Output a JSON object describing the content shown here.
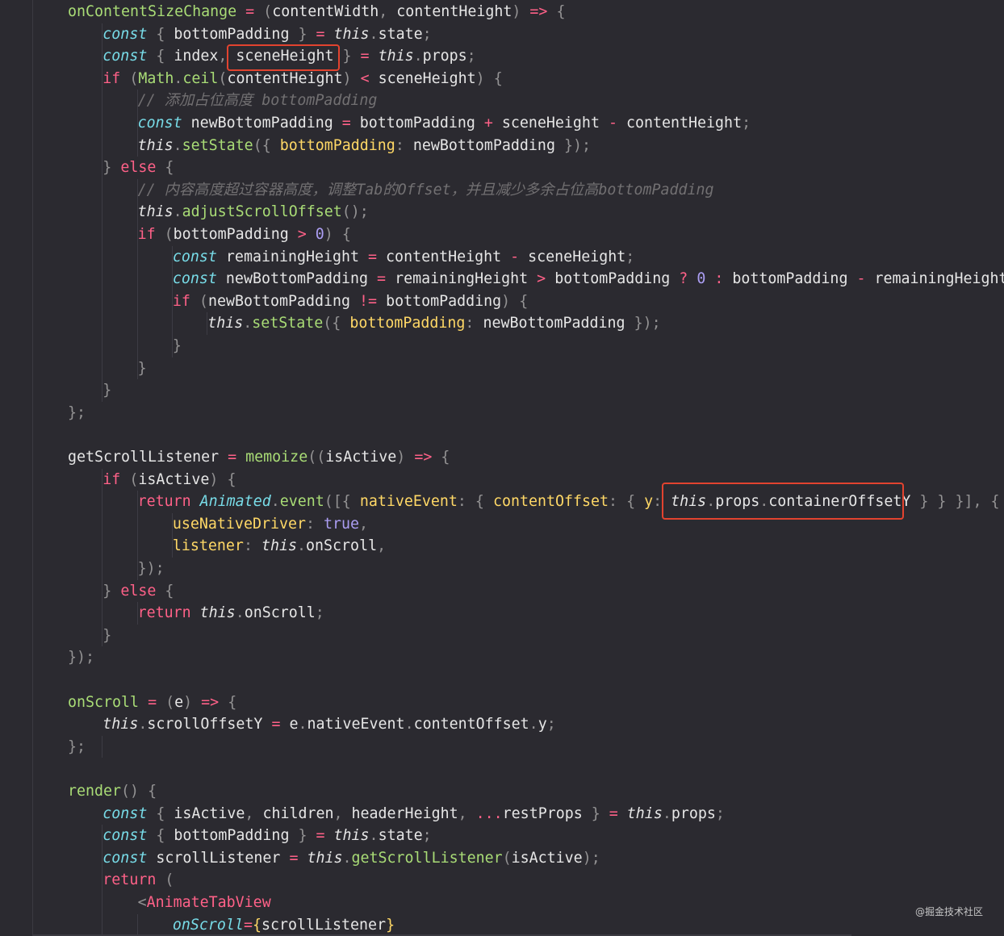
{
  "colors": {
    "background": "#2b2a30",
    "plain": "#e6e6e6",
    "function": "#a9dc76",
    "keyword": "#ff6188",
    "storage": "#78dce8",
    "this": "#e6e6e6",
    "punct": "#939293",
    "prop": "#ffd866",
    "number": "#ab9df2",
    "comment": "#727072",
    "highlight_border": "#e2432f"
  },
  "watermark": "@掘金技术社区",
  "lines": [
    {
      "indent": 2,
      "tokens": [
        [
          "onContentSizeChange",
          "fn"
        ],
        [
          " ",
          "pl"
        ],
        [
          "=",
          "kw"
        ],
        [
          " ",
          "pl"
        ],
        [
          "(",
          "pu"
        ],
        [
          "contentWidth",
          "pl"
        ],
        [
          ", ",
          "pu"
        ],
        [
          "contentHeight",
          "pl"
        ],
        [
          ")",
          "pu"
        ],
        [
          " ",
          "pl"
        ],
        [
          "=>",
          "kw"
        ],
        [
          " ",
          "pl"
        ],
        [
          "{",
          "pu"
        ]
      ]
    },
    {
      "indent": 3,
      "tokens": [
        [
          "const",
          "st"
        ],
        [
          " ",
          "pl"
        ],
        [
          "{",
          "pu"
        ],
        [
          " bottomPadding ",
          "pl"
        ],
        [
          "}",
          "pu"
        ],
        [
          " ",
          "pl"
        ],
        [
          "=",
          "kw"
        ],
        [
          " ",
          "pl"
        ],
        [
          "this",
          "th"
        ],
        [
          ".",
          "pu"
        ],
        [
          "state",
          "pl"
        ],
        [
          ";",
          "pu"
        ]
      ]
    },
    {
      "indent": 3,
      "tokens": [
        [
          "const",
          "st"
        ],
        [
          " ",
          "pl"
        ],
        [
          "{",
          "pu"
        ],
        [
          " index",
          "pl"
        ],
        [
          ",",
          "pu"
        ],
        [
          " sceneHeight ",
          "pl"
        ],
        [
          "}",
          "pu"
        ],
        [
          " ",
          "pl"
        ],
        [
          "=",
          "kw"
        ],
        [
          " ",
          "pl"
        ],
        [
          "this",
          "th"
        ],
        [
          ".",
          "pu"
        ],
        [
          "props",
          "pl"
        ],
        [
          ";",
          "pu"
        ]
      ]
    },
    {
      "indent": 3,
      "tokens": [
        [
          "if",
          "kw"
        ],
        [
          " ",
          "pl"
        ],
        [
          "(",
          "pu"
        ],
        [
          "Math",
          "fn"
        ],
        [
          ".",
          "pu"
        ],
        [
          "ceil",
          "fn"
        ],
        [
          "(",
          "pu"
        ],
        [
          "contentHeight",
          "pl"
        ],
        [
          ")",
          "pu"
        ],
        [
          " ",
          "pl"
        ],
        [
          "<",
          "kw"
        ],
        [
          " sceneHeight",
          "pl"
        ],
        [
          ")",
          "pu"
        ],
        [
          " ",
          "pl"
        ],
        [
          "{",
          "pu"
        ]
      ]
    },
    {
      "indent": 4,
      "tokens": [
        [
          "// 添加占位高度 bottomPadding",
          "cm"
        ]
      ]
    },
    {
      "indent": 4,
      "tokens": [
        [
          "const",
          "st"
        ],
        [
          " newBottomPadding ",
          "pl"
        ],
        [
          "=",
          "kw"
        ],
        [
          " bottomPadding ",
          "pl"
        ],
        [
          "+",
          "kw"
        ],
        [
          " sceneHeight ",
          "pl"
        ],
        [
          "-",
          "kw"
        ],
        [
          " contentHeight",
          "pl"
        ],
        [
          ";",
          "pu"
        ]
      ]
    },
    {
      "indent": 4,
      "tokens": [
        [
          "this",
          "th"
        ],
        [
          ".",
          "pu"
        ],
        [
          "setState",
          "fn"
        ],
        [
          "({",
          "pu"
        ],
        [
          " ",
          "pl"
        ],
        [
          "bottomPadding",
          "pr"
        ],
        [
          ":",
          "pu"
        ],
        [
          " newBottomPadding ",
          "pl"
        ],
        [
          "});",
          "pu"
        ]
      ]
    },
    {
      "indent": 3,
      "tokens": [
        [
          "}",
          "pu"
        ],
        [
          " ",
          "pl"
        ],
        [
          "else",
          "kw"
        ],
        [
          " ",
          "pl"
        ],
        [
          "{",
          "pu"
        ]
      ]
    },
    {
      "indent": 4,
      "tokens": [
        [
          "// 内容高度超过容器高度，调整Tab的Offset，并且减少多余占位高bottomPadding",
          "cm"
        ]
      ]
    },
    {
      "indent": 4,
      "tokens": [
        [
          "this",
          "th"
        ],
        [
          ".",
          "pu"
        ],
        [
          "adjustScrollOffset",
          "fn"
        ],
        [
          "();",
          "pu"
        ]
      ]
    },
    {
      "indent": 4,
      "tokens": [
        [
          "if",
          "kw"
        ],
        [
          " ",
          "pl"
        ],
        [
          "(",
          "pu"
        ],
        [
          "bottomPadding ",
          "pl"
        ],
        [
          ">",
          "kw"
        ],
        [
          " ",
          "pl"
        ],
        [
          "0",
          "nu"
        ],
        [
          ")",
          "pu"
        ],
        [
          " ",
          "pl"
        ],
        [
          "{",
          "pu"
        ]
      ]
    },
    {
      "indent": 5,
      "tokens": [
        [
          "const",
          "st"
        ],
        [
          " remainingHeight ",
          "pl"
        ],
        [
          "=",
          "kw"
        ],
        [
          " contentHeight ",
          "pl"
        ],
        [
          "-",
          "kw"
        ],
        [
          " sceneHeight",
          "pl"
        ],
        [
          ";",
          "pu"
        ]
      ]
    },
    {
      "indent": 5,
      "tokens": [
        [
          "const",
          "st"
        ],
        [
          " newBottomPadding ",
          "pl"
        ],
        [
          "=",
          "kw"
        ],
        [
          " remainingHeight ",
          "pl"
        ],
        [
          ">",
          "kw"
        ],
        [
          " bottomPadding ",
          "pl"
        ],
        [
          "?",
          "kw"
        ],
        [
          " ",
          "pl"
        ],
        [
          "0",
          "nu"
        ],
        [
          " ",
          "pl"
        ],
        [
          ":",
          "kw"
        ],
        [
          " bottomPadding ",
          "pl"
        ],
        [
          "-",
          "kw"
        ],
        [
          " remainingHeight",
          "pl"
        ],
        [
          ";",
          "pu"
        ]
      ]
    },
    {
      "indent": 5,
      "tokens": [
        [
          "if",
          "kw"
        ],
        [
          " ",
          "pl"
        ],
        [
          "(",
          "pu"
        ],
        [
          "newBottomPadding ",
          "pl"
        ],
        [
          "!=",
          "kw"
        ],
        [
          " bottomPadding",
          "pl"
        ],
        [
          ")",
          "pu"
        ],
        [
          " ",
          "pl"
        ],
        [
          "{",
          "pu"
        ]
      ]
    },
    {
      "indent": 6,
      "tokens": [
        [
          "this",
          "th"
        ],
        [
          ".",
          "pu"
        ],
        [
          "setState",
          "fn"
        ],
        [
          "({",
          "pu"
        ],
        [
          " ",
          "pl"
        ],
        [
          "bottomPadding",
          "pr"
        ],
        [
          ":",
          "pu"
        ],
        [
          " newBottomPadding ",
          "pl"
        ],
        [
          "});",
          "pu"
        ]
      ]
    },
    {
      "indent": 5,
      "tokens": [
        [
          "}",
          "pu"
        ]
      ]
    },
    {
      "indent": 4,
      "tokens": [
        [
          "}",
          "pu"
        ]
      ]
    },
    {
      "indent": 3,
      "tokens": [
        [
          "}",
          "pu"
        ]
      ]
    },
    {
      "indent": 2,
      "tokens": [
        [
          "};",
          "pu"
        ]
      ]
    },
    {
      "indent": 2,
      "tokens": []
    },
    {
      "indent": 2,
      "tokens": [
        [
          "getScrollListener ",
          "pl"
        ],
        [
          "=",
          "kw"
        ],
        [
          " ",
          "pl"
        ],
        [
          "memoize",
          "fn"
        ],
        [
          "((",
          "pu"
        ],
        [
          "isActive",
          "pl"
        ],
        [
          ")",
          "pu"
        ],
        [
          " ",
          "pl"
        ],
        [
          "=>",
          "kw"
        ],
        [
          " ",
          "pl"
        ],
        [
          "{",
          "pu"
        ]
      ]
    },
    {
      "indent": 3,
      "tokens": [
        [
          "if",
          "kw"
        ],
        [
          " ",
          "pl"
        ],
        [
          "(",
          "pu"
        ],
        [
          "isActive",
          "pl"
        ],
        [
          ")",
          "pu"
        ],
        [
          " ",
          "pl"
        ],
        [
          "{",
          "pu"
        ]
      ]
    },
    {
      "indent": 4,
      "tokens": [
        [
          "return",
          "kw"
        ],
        [
          " ",
          "pl"
        ],
        [
          "Animated",
          "st"
        ],
        [
          ".",
          "pu"
        ],
        [
          "event",
          "fn"
        ],
        [
          "([{",
          "pu"
        ],
        [
          " ",
          "pl"
        ],
        [
          "nativeEvent",
          "pr"
        ],
        [
          ":",
          "pu"
        ],
        [
          " ",
          "pl"
        ],
        [
          "{",
          "pu"
        ],
        [
          " ",
          "pl"
        ],
        [
          "contentOffset",
          "pr"
        ],
        [
          ":",
          "pu"
        ],
        [
          " ",
          "pl"
        ],
        [
          "{",
          "pu"
        ],
        [
          " ",
          "pl"
        ],
        [
          "y",
          "pr"
        ],
        [
          ":",
          "pu"
        ],
        [
          " ",
          "pl"
        ],
        [
          "this",
          "th"
        ],
        [
          ".",
          "pu"
        ],
        [
          "props",
          "pl"
        ],
        [
          ".",
          "pu"
        ],
        [
          "containerOffsetY",
          "pl"
        ],
        [
          " ",
          "pl"
        ],
        [
          "}",
          "pu"
        ],
        [
          " ",
          "pl"
        ],
        [
          "}",
          "pu"
        ],
        [
          " ",
          "pl"
        ],
        [
          "}],",
          "pu"
        ],
        [
          " ",
          "pl"
        ],
        [
          "{",
          "pu"
        ]
      ]
    },
    {
      "indent": 5,
      "tokens": [
        [
          "useNativeDriver",
          "pr"
        ],
        [
          ":",
          "pu"
        ],
        [
          " ",
          "pl"
        ],
        [
          "true",
          "nu"
        ],
        [
          ",",
          "pu"
        ]
      ]
    },
    {
      "indent": 5,
      "tokens": [
        [
          "listener",
          "pr"
        ],
        [
          ":",
          "pu"
        ],
        [
          " ",
          "pl"
        ],
        [
          "this",
          "th"
        ],
        [
          ".",
          "pu"
        ],
        [
          "onScroll",
          "pl"
        ],
        [
          ",",
          "pu"
        ]
      ]
    },
    {
      "indent": 4,
      "tokens": [
        [
          "});",
          "pu"
        ]
      ]
    },
    {
      "indent": 3,
      "tokens": [
        [
          "}",
          "pu"
        ],
        [
          " ",
          "pl"
        ],
        [
          "else",
          "kw"
        ],
        [
          " ",
          "pl"
        ],
        [
          "{",
          "pu"
        ]
      ]
    },
    {
      "indent": 4,
      "tokens": [
        [
          "return",
          "kw"
        ],
        [
          " ",
          "pl"
        ],
        [
          "this",
          "th"
        ],
        [
          ".",
          "pu"
        ],
        [
          "onScroll",
          "pl"
        ],
        [
          ";",
          "pu"
        ]
      ]
    },
    {
      "indent": 3,
      "tokens": [
        [
          "}",
          "pu"
        ]
      ]
    },
    {
      "indent": 2,
      "tokens": [
        [
          "});",
          "pu"
        ]
      ]
    },
    {
      "indent": 2,
      "tokens": []
    },
    {
      "indent": 2,
      "tokens": [
        [
          "onScroll",
          "fn"
        ],
        [
          " ",
          "pl"
        ],
        [
          "=",
          "kw"
        ],
        [
          " ",
          "pl"
        ],
        [
          "(",
          "pu"
        ],
        [
          "e",
          "pl"
        ],
        [
          ")",
          "pu"
        ],
        [
          " ",
          "pl"
        ],
        [
          "=>",
          "kw"
        ],
        [
          " ",
          "pl"
        ],
        [
          "{",
          "pu"
        ]
      ]
    },
    {
      "indent": 3,
      "tokens": [
        [
          "this",
          "th"
        ],
        [
          ".",
          "pu"
        ],
        [
          "scrollOffsetY ",
          "pl"
        ],
        [
          "=",
          "kw"
        ],
        [
          " e",
          "pl"
        ],
        [
          ".",
          "pu"
        ],
        [
          "nativeEvent",
          "pl"
        ],
        [
          ".",
          "pu"
        ],
        [
          "contentOffset",
          "pl"
        ],
        [
          ".",
          "pu"
        ],
        [
          "y",
          "pl"
        ],
        [
          ";",
          "pu"
        ]
      ]
    },
    {
      "indent": 2,
      "tokens": [
        [
          "};",
          "pu"
        ]
      ]
    },
    {
      "indent": 2,
      "tokens": []
    },
    {
      "indent": 2,
      "tokens": [
        [
          "render",
          "fn"
        ],
        [
          "()",
          "pu"
        ],
        [
          " ",
          "pl"
        ],
        [
          "{",
          "pu"
        ]
      ]
    },
    {
      "indent": 3,
      "tokens": [
        [
          "const",
          "st"
        ],
        [
          " ",
          "pl"
        ],
        [
          "{",
          "pu"
        ],
        [
          " isActive",
          "pl"
        ],
        [
          ",",
          "pu"
        ],
        [
          " children",
          "pl"
        ],
        [
          ",",
          "pu"
        ],
        [
          " headerHeight",
          "pl"
        ],
        [
          ",",
          "pu"
        ],
        [
          " ",
          "pl"
        ],
        [
          "...",
          "kw"
        ],
        [
          "restProps ",
          "pl"
        ],
        [
          "}",
          "pu"
        ],
        [
          " ",
          "pl"
        ],
        [
          "=",
          "kw"
        ],
        [
          " ",
          "pl"
        ],
        [
          "this",
          "th"
        ],
        [
          ".",
          "pu"
        ],
        [
          "props",
          "pl"
        ],
        [
          ";",
          "pu"
        ]
      ]
    },
    {
      "indent": 3,
      "tokens": [
        [
          "const",
          "st"
        ],
        [
          " ",
          "pl"
        ],
        [
          "{",
          "pu"
        ],
        [
          " bottomPadding ",
          "pl"
        ],
        [
          "}",
          "pu"
        ],
        [
          " ",
          "pl"
        ],
        [
          "=",
          "kw"
        ],
        [
          " ",
          "pl"
        ],
        [
          "this",
          "th"
        ],
        [
          ".",
          "pu"
        ],
        [
          "state",
          "pl"
        ],
        [
          ";",
          "pu"
        ]
      ]
    },
    {
      "indent": 3,
      "tokens": [
        [
          "const",
          "st"
        ],
        [
          " scrollListener ",
          "pl"
        ],
        [
          "=",
          "kw"
        ],
        [
          " ",
          "pl"
        ],
        [
          "this",
          "th"
        ],
        [
          ".",
          "pu"
        ],
        [
          "getScrollListener",
          "fn"
        ],
        [
          "(",
          "pu"
        ],
        [
          "isActive",
          "pl"
        ],
        [
          ");",
          "pu"
        ]
      ]
    },
    {
      "indent": 3,
      "tokens": [
        [
          "return",
          "kw"
        ],
        [
          " ",
          "pl"
        ],
        [
          "(",
          "pu"
        ]
      ]
    },
    {
      "indent": 4,
      "tokens": [
        [
          "<",
          "pu"
        ],
        [
          "AnimateTabView",
          "kw"
        ]
      ]
    },
    {
      "indent": 5,
      "tokens": [
        [
          "onScroll",
          "st"
        ],
        [
          "=",
          "kw"
        ],
        [
          "{",
          "prb"
        ],
        [
          "scrollListener",
          "pl"
        ],
        [
          "}",
          "prb"
        ]
      ]
    }
  ]
}
